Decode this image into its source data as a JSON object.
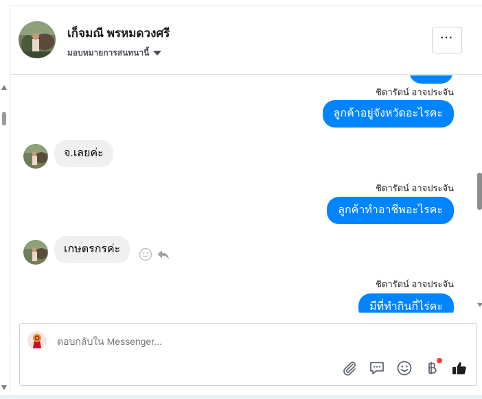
{
  "header": {
    "name": "เก็จมณี พรหมดวงศรี",
    "assign_label": "มอบหมายการสนทนานี้",
    "more_label": "···"
  },
  "messages": [
    {
      "type": "out",
      "sender": "ชิดารัตน์ อาจประจัน",
      "text": "ลูกค้าอยู่จังหวัดอะไรคะ"
    },
    {
      "type": "in",
      "text": "จ.เลยค่ะ"
    },
    {
      "type": "out",
      "sender": "ชิดารัตน์ อาจประจัน",
      "text": "ลูกค้าทำอาชีพอะไรคะ"
    },
    {
      "type": "in",
      "text": "เกษตรกรค่ะ"
    },
    {
      "type": "out",
      "sender": "ชิดารัตน์ อาจประจัน",
      "text": "มีที่ทำกินกี่ไร่คะ"
    }
  ],
  "composer": {
    "placeholder": "ตอบกลับใน Messenger...",
    "tools": [
      "paperclip-icon",
      "speech-bubble-icon",
      "smiley-icon",
      "baht-icon",
      "thumbs-up-icon"
    ]
  },
  "colors": {
    "accent": "#0084ff",
    "incoming_bubble": "#f1f0f0",
    "notification_dot": "#fa3e3e"
  }
}
